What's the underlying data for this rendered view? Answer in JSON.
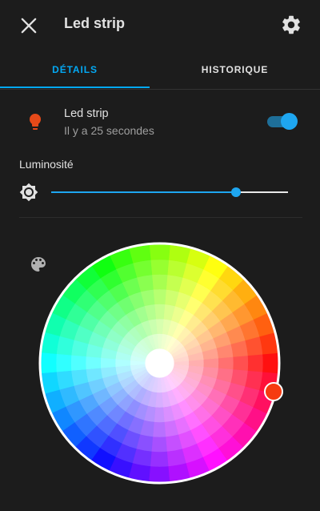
{
  "header": {
    "title": "Led strip",
    "close_icon": "close-icon",
    "settings_icon": "gear-icon"
  },
  "tabs": [
    {
      "label": "DÉTAILS",
      "active": true
    },
    {
      "label": "HISTORIQUE",
      "active": false
    }
  ],
  "entity": {
    "name": "Led strip",
    "last_changed": "Il y a 25 secondes",
    "icon": "lightbulb-icon",
    "icon_color": "#e64a19",
    "state_on": true
  },
  "brightness": {
    "label": "Luminosité",
    "icon": "brightness-icon",
    "value_fraction": 0.779
  },
  "color": {
    "palette_icon": "palette-icon",
    "selected_color": "#f63b11",
    "selected_hue_deg": 8,
    "selected_saturation": 0.97
  },
  "colors": {
    "accent": "#03a9f4",
    "background": "#1c1c1c"
  }
}
